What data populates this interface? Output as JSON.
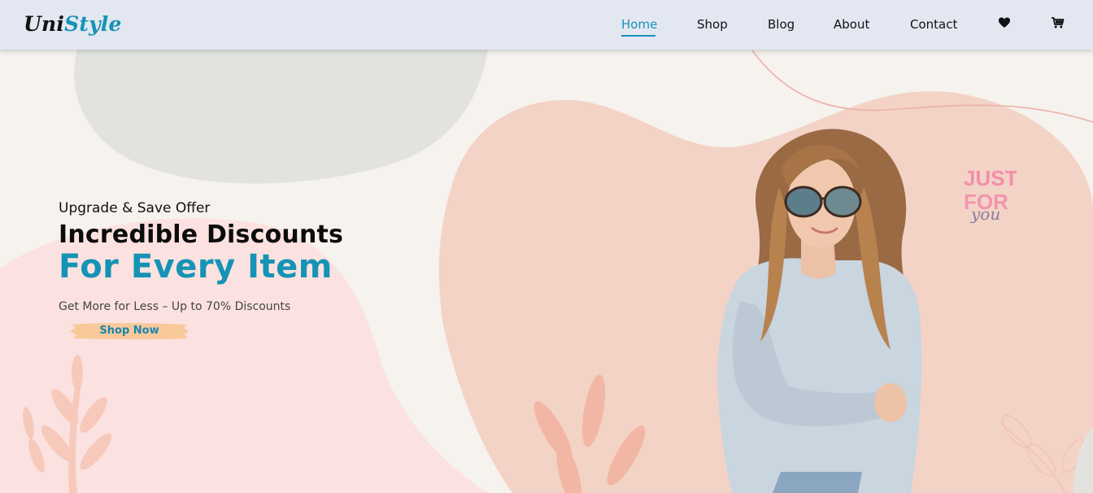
{
  "brand": {
    "logo_part1": "Uni",
    "logo_part2": "Style"
  },
  "nav": {
    "items": [
      {
        "label": "Home",
        "active": true
      },
      {
        "label": "Shop",
        "active": false
      },
      {
        "label": "Blog",
        "active": false
      },
      {
        "label": "About",
        "active": false
      },
      {
        "label": "Contact",
        "active": false
      }
    ],
    "icons": [
      "heart-icon",
      "cart-icon"
    ]
  },
  "hero": {
    "eyebrow": "Upgrade & Save Offer",
    "title_line1": "Incredible Discounts",
    "title_line2": "For Every Item",
    "subtitle": "Get More for Less – Up to 70% Discounts",
    "cta_label": "Shop Now",
    "badge_lines": [
      "JUST",
      "FOR",
      "you"
    ]
  },
  "colors": {
    "accent": "#1593b5",
    "nav_bg": "#e3e7f1",
    "page_bg": "#f6f2ee",
    "cta_brush": "#f8c99b",
    "blob_peach": "#f3d3c6",
    "blob_pink": "#fbe2e0",
    "blob_gray": "#e2e3df"
  }
}
